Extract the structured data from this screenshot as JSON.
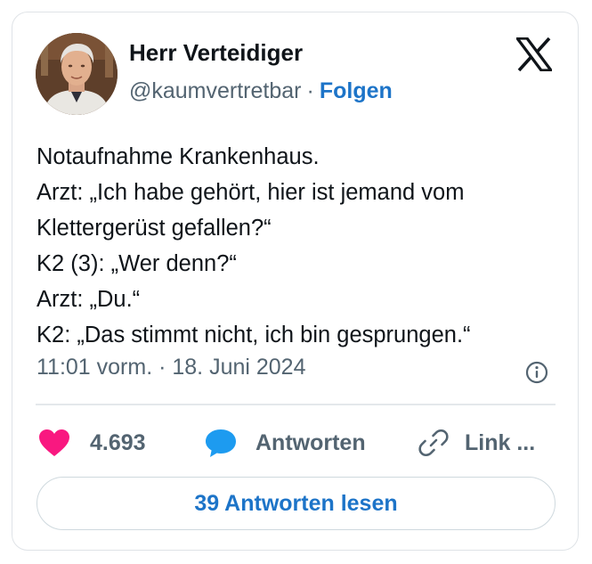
{
  "author": {
    "name": "Herr Verteidiger",
    "handle": "@kaumvertretbar",
    "separator": "·",
    "follow_label": "Folgen"
  },
  "brand": {
    "logo_icon": "x-logo-icon"
  },
  "tweet": {
    "lines": [
      "Notaufnahme Krankenhaus.",
      "Arzt: „Ich habe gehört, hier ist jemand vom",
      "Klettergerüst gefallen?“",
      "K2 (3): „Wer denn?“",
      "Arzt: „Du.“",
      "K2: „Das stimmt nicht, ich bin gesprungen.“"
    ],
    "timestamp": "11:01 vorm. · 18. Juni 2024"
  },
  "actions": {
    "like_count": "4.693",
    "reply_label": "Antworten",
    "link_label": "Link ..."
  },
  "read_replies_label": "39 Antworten lesen",
  "colors": {
    "heart": "#f91880",
    "reply_bubble": "#1d9bf0",
    "link_blue": "#1d74c8",
    "muted": "#536471",
    "text": "#0f1419"
  }
}
